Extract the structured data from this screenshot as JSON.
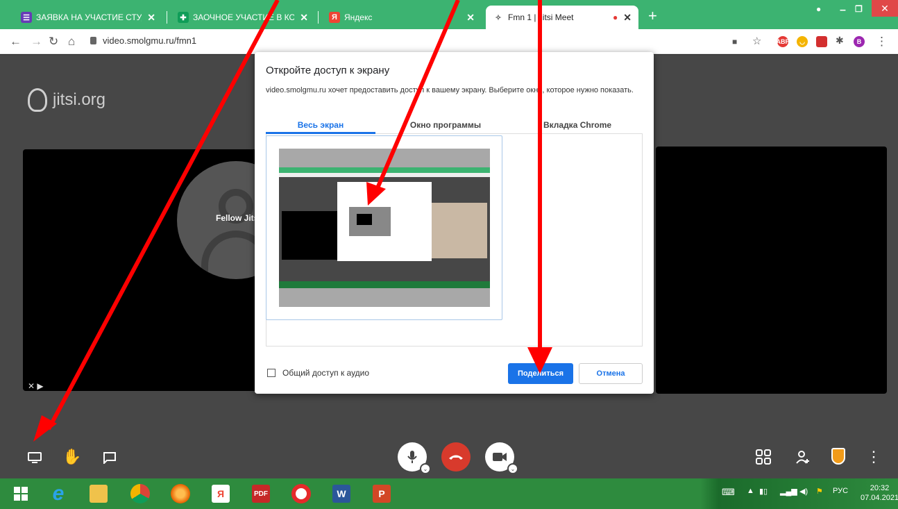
{
  "browser": {
    "tabs": [
      {
        "label": "ЗАЯВКА НА УЧАСТИЕ СТУДЕНТО",
        "favicon": "forms-icon",
        "color": "#673ab7"
      },
      {
        "label": "ЗАОЧНОЕ УЧАСТИЕ В КОНФЕРЕ",
        "favicon": "cross-plus-icon",
        "color": "#0f9d58"
      },
      {
        "label": "Яндекс",
        "favicon": "yandex-icon",
        "color": "#e43"
      },
      {
        "label": "Fmn 1 | Jitsi Meet",
        "favicon": "jitsi-icon",
        "color": "#555"
      }
    ],
    "url": "video.smolgmu.ru/fmn1",
    "extensions": [
      "ABP",
      "B"
    ]
  },
  "jitsi": {
    "logo_text": "jitsi.org",
    "participant_name": "Fellow Jitst",
    "toolbar_left": [
      "share-screen-icon",
      "raise-hand-icon",
      "chat-icon"
    ],
    "toolbar_center": [
      "microphone-icon",
      "hangup-icon",
      "camera-icon"
    ],
    "toolbar_right": [
      "tile-view-icon",
      "invite-icon",
      "security-icon",
      "more-icon"
    ]
  },
  "dialog": {
    "title": "Откройте доступ к экрану",
    "description": "video.smolgmu.ru хочет предоставить доступ к вашему экрану. Выберите окно, которое нужно показать.",
    "tabs": [
      {
        "label": "Весь экран",
        "active": true
      },
      {
        "label": "Окно программы",
        "active": false
      },
      {
        "label": "Вкладка Chrome",
        "active": false
      }
    ],
    "audio_label": "Общий доступ к аудио",
    "share_button": "Поделиться",
    "cancel_button": "Отмена",
    "accent": "#1a73e8"
  },
  "taskbar": {
    "apps": [
      "windows-start-icon",
      "internet-explorer-icon",
      "file-explorer-icon",
      "chrome-icon",
      "firefox-icon",
      "yandex-browser-icon",
      "pdf-app-icon",
      "opera-icon",
      "word-icon",
      "powerpoint-icon"
    ],
    "language": "РУС",
    "time": "20:32",
    "date": "07.04.2021"
  },
  "annotation_color": "#ff0000"
}
